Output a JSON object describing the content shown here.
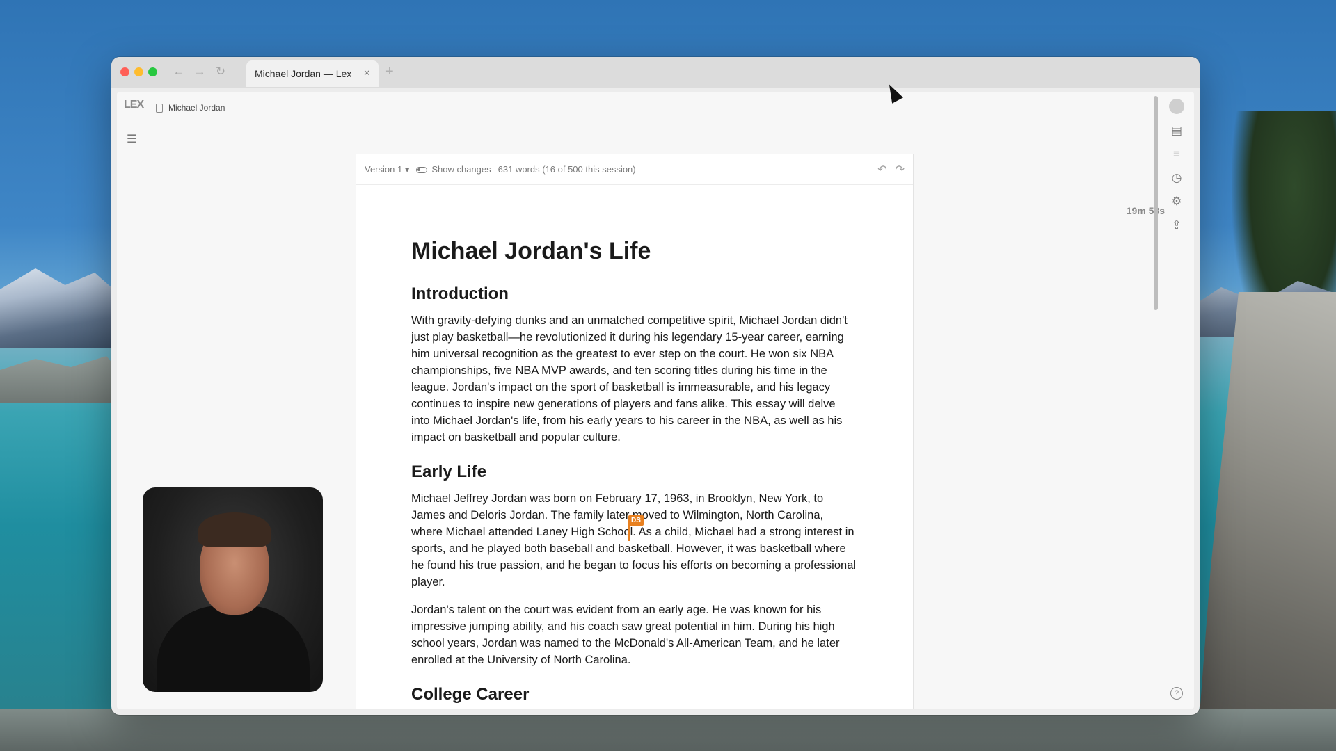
{
  "browser": {
    "tab_title": "Michael Jordan — Lex",
    "tab_close": "×",
    "new_tab": "+",
    "nav_back": "←",
    "nav_forward": "→",
    "nav_refresh": "↻"
  },
  "app": {
    "logo": "LEX",
    "breadcrumb": "Michael Jordan",
    "outline_icon": "☰",
    "timer": "19m 58s",
    "help": "?"
  },
  "toolbar": {
    "version": "Version 1 ▾",
    "show_changes": "Show changes",
    "word_count": "631 words (16 of 500 this session)",
    "undo": "↶",
    "redo": "↷"
  },
  "document": {
    "title": "Michael Jordan's Life",
    "sections": [
      {
        "heading": "Introduction",
        "paragraphs": [
          "With gravity-defying dunks and an unmatched competitive spirit, Michael Jordan didn't just play basketball—he revolutionized it during his legendary 15-year career, earning him universal recognition as the greatest to ever step on the court. He won six NBA championships, five NBA MVP awards, and ten scoring titles during his time in the league. Jordan's impact on the sport of basketball is immeasurable, and his legacy continues to inspire new generations of players and fans alike. This essay will delve into Michael Jordan's life, from his early years to his career in the NBA, as well as his impact on basketball and popular culture."
        ]
      },
      {
        "heading": "Early Life",
        "paragraphs": [
          "Michael Jeffrey Jordan was born on February 17, 1963, in Brooklyn, New York, to James and Deloris Jordan. The family later moved to Wilmington, North Carolina, where Michael attended Laney High School. As a child, Michael had a strong interest in sports, and he played both baseball and basketball. However, it was basketball where he found his true passion, and he began to focus his efforts on becoming a professional player.",
          "Jordan's talent on the court was evident from an early age. He was known for his impressive jumping ability, and his coach saw great potential in him. During his high school years, Jordan was named to the McDonald's All-American Team, and he later enrolled at the University of North Carolina."
        ]
      },
      {
        "heading": "College Career",
        "paragraphs": []
      }
    ]
  },
  "collab_cursor": {
    "initials": "DS",
    "color": "#e8801f"
  },
  "rail_icons": [
    "avatar",
    "comment-icon",
    "checklist-icon",
    "stopwatch-icon",
    "gear-icon",
    "share-icon"
  ],
  "colors": {
    "accent": "#e8801f",
    "close": "#ff5f57",
    "minimize": "#febc2e",
    "maximize": "#28c840"
  }
}
